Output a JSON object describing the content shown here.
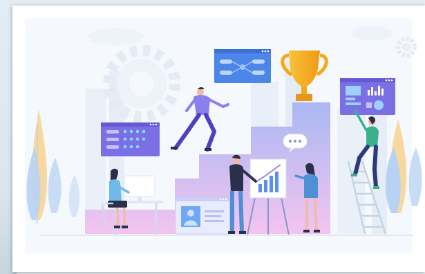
{
  "illustration": {
    "subject": "career growth",
    "icons": [
      "trophy-icon",
      "gear-icon",
      "chat-bubble-icon",
      "user-profile-icon",
      "bar-chart-icon",
      "flowchart-icon"
    ],
    "colors": {
      "stairs_top": "#a9b8f3",
      "stairs_bottom": "#f3c4ef",
      "panel_purple": "#7b6fe6",
      "panel_blue": "#5a8ef0",
      "trophy_gold": "#f5b21f",
      "foliage_yellow": "#f7d9a0",
      "foliage_blue": "#b8d2f4",
      "skyline": "#e9eff8"
    }
  }
}
